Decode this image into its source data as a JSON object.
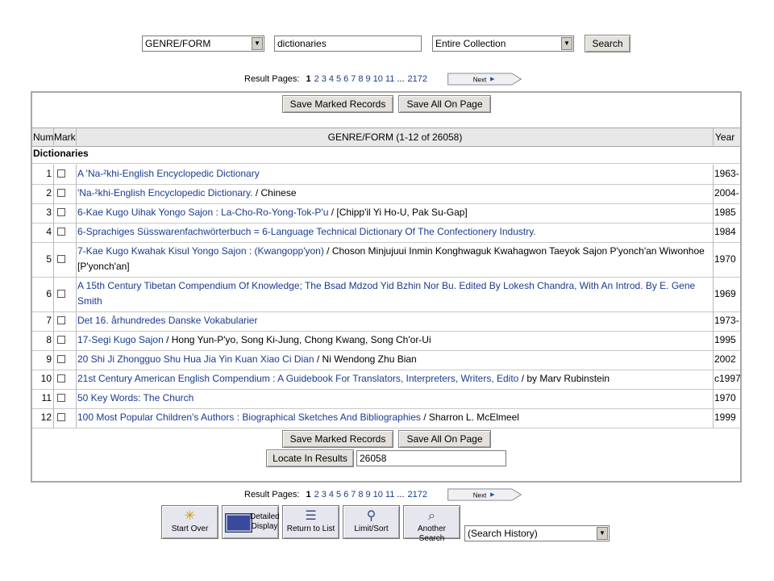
{
  "search": {
    "field_select": "GENRE/FORM",
    "query": "dictionaries",
    "scope_select": "Entire Collection",
    "search_button": "Search"
  },
  "pager": {
    "label": "Result Pages:",
    "current": "1",
    "pages": [
      "2",
      "3",
      "4",
      "5",
      "6",
      "7",
      "8",
      "9",
      "10",
      "11"
    ],
    "ellipsis": "...",
    "last": "2172",
    "next": "Next"
  },
  "actions": {
    "save_marked": "Save Marked Records",
    "save_all": "Save All On Page",
    "locate": "Locate In Results",
    "locate_value": "26058"
  },
  "table": {
    "col_num": "Num",
    "col_mark": "Mark",
    "col_title": "GENRE/FORM (1-12 of 26058)",
    "col_year": "Year",
    "section": "Dictionaries",
    "rows": [
      {
        "num": "1",
        "title": "A 'Na-²khi-English Encyclopedic Dictionary",
        "extra": "",
        "year": "1963-"
      },
      {
        "num": "2",
        "title": "'Na-²khi-English Encyclopedic Dictionary.",
        "extra": " / Chinese",
        "year": "2004-"
      },
      {
        "num": "3",
        "title": "6-Kae Kugo Uihak Yongo Sajon : La-Cho-Ro-Yong-Tok-P'u",
        "extra": " / [Chipp'il Yi Ho-U, Pak Su-Gap]",
        "year": "1985"
      },
      {
        "num": "4",
        "title": "6-Sprachiges Süsswarenfachwörterbuch = 6-Language Technical Dictionary Of The Confectionery Industry.",
        "extra": "",
        "year": "1984"
      },
      {
        "num": "5",
        "title": "7-Kae Kugo Kwahak Kisul Yongo Sajon : (Kwangopp'yon)",
        "extra": " / Choson Minjujuui Inmin Konghwaguk Kwahagwon Taeyok Sajon P'yonch'an Wiwonhoe",
        "extra2": "[P'yonch'an]",
        "year": "1970"
      },
      {
        "num": "6",
        "title": "A 15th Century Tibetan Compendium Of Knowledge; The Bsad Mdzod Yid Bzhin Nor Bu. Edited By Lokesh Chandra, With An Introd. By E. Gene",
        "title2": "Smith",
        "extra": "",
        "year": "1969"
      },
      {
        "num": "7",
        "title": "Det 16. århundredes Danske Vokabularier",
        "extra": "",
        "year": "1973-"
      },
      {
        "num": "8",
        "title": "17-Segi Kugo Sajon",
        "extra": " / Hong Yun-P'yo, Song Ki-Jung, Chong Kwang, Song Ch'or-Ui",
        "year": "1995"
      },
      {
        "num": "9",
        "title": "20 Shi Ji Zhongguo Shu Hua Jia Yin Kuan Xiao Ci Dian",
        "extra": " / Ni Wendong Zhu Bian",
        "year": "2002"
      },
      {
        "num": "10",
        "title": "21st Century American English Compendium : A Guidebook For Translators, Interpreters, Writers, Edito",
        "extra": " / by Marv Rubinstein",
        "year": "c1997"
      },
      {
        "num": "11",
        "title": "50 Key Words: The Church",
        "extra": "",
        "year": "1970"
      },
      {
        "num": "12",
        "title": "100 Most Popular Children's Authors : Biographical Sketches And Bibliographies",
        "extra": " / Sharron L. McElmeel",
        "year": "1999"
      }
    ]
  },
  "toolbar": {
    "start_over": "Start Over",
    "detailed_display": "Detailed Display",
    "return_to_list": "Return to List",
    "limit_sort": "Limit/Sort",
    "another_search": "Another Search",
    "history_select": "(Search History)"
  },
  "colors": {
    "link": "#1a3b8f",
    "header_bg": "#e8e8e8",
    "border": "#a8a8a8"
  }
}
